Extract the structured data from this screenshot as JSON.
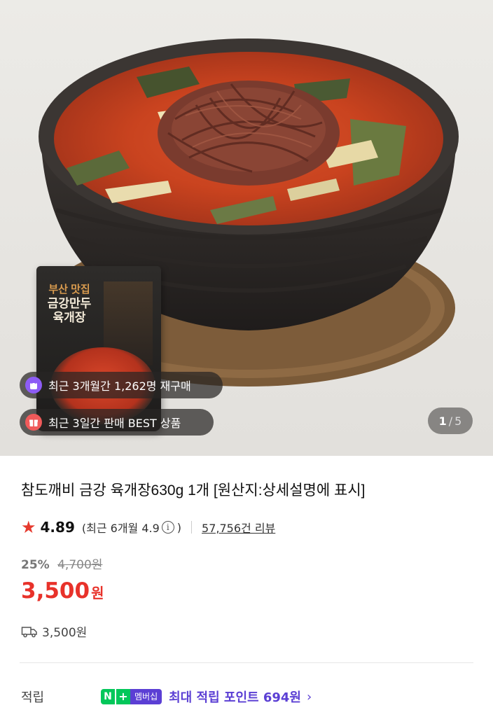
{
  "gallery": {
    "package_text": {
      "line1": "부산 맛집",
      "line2": "금강만두",
      "line3": "육개장"
    },
    "badges": [
      {
        "icon": "shopping-bag-icon",
        "text": "최근 3개월간 1,262명 재구매",
        "icon_color": "#8d5cf5"
      },
      {
        "icon": "gift-icon",
        "text": "최근 3일간 판매 BEST 상품",
        "icon_color": "#f05a5a"
      }
    ],
    "counter": {
      "current": "1",
      "separator": "/",
      "total": "5"
    }
  },
  "product": {
    "title": "참도깨비 금강 육개장630g 1개 [원산지:상세설명에 표시]",
    "rating": "4.89",
    "recent_rating_prefix": "(최근 6개월 4.9",
    "recent_rating_suffix": ")",
    "review_count": "57,756건 리뷰",
    "discount_rate": "25%",
    "original_price": "4,700원",
    "price": "3,500",
    "price_unit": "원",
    "shipping_fee": "3,500원"
  },
  "points": {
    "label": "적립",
    "membership_badge": {
      "n": "N",
      "plus": "+",
      "text": "멤버십"
    },
    "text": "최대 적립 포인트 694원",
    "chevron": "›"
  },
  "colors": {
    "accent_red": "#e8322a",
    "star": "#e63a2e",
    "membership_purple": "#5b3fd4",
    "naver_green": "#03c75a"
  }
}
